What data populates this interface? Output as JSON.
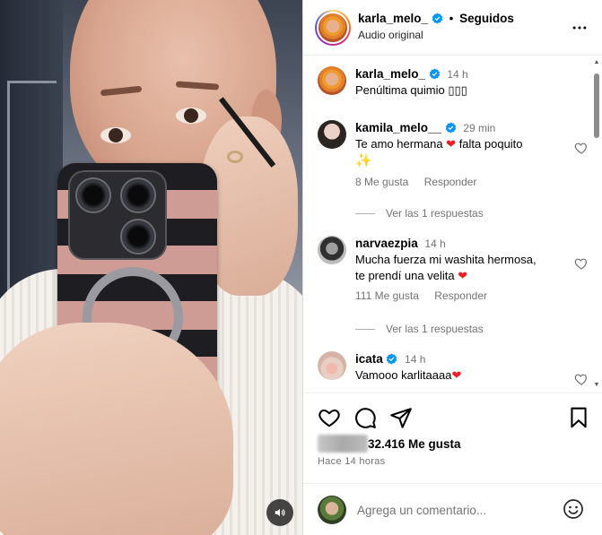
{
  "post": {
    "author": "karla_melo_",
    "follow_status": "Seguidos",
    "separator": "•",
    "audio": "Audio original",
    "more_icon": "more-horizontal-icon"
  },
  "comments": [
    {
      "username": "karla_melo_",
      "verified": true,
      "time": "14 h",
      "text": "Penúltima quimio ▯▯▯",
      "is_caption": true
    },
    {
      "username": "kamila_melo__",
      "verified": true,
      "time": "29 min",
      "text_before": "Te amo hermana ",
      "text_after": " falta poquito",
      "emoji_heart": "❤",
      "emoji_sparkle": "✨",
      "likes": "8 Me gusta",
      "reply": "Responder",
      "view_replies": "Ver las 1 respuestas"
    },
    {
      "username": "narvaezpia",
      "verified": false,
      "time": "14 h",
      "text_line1": "Mucha fuerza mi washita hermosa,",
      "text_line2": "te prendí una velita ",
      "emoji_heart": "❤",
      "likes": "111 Me gusta",
      "reply": "Responder",
      "view_replies": "Ver las 1 respuestas"
    },
    {
      "username": "icata",
      "verified": true,
      "time": "14 h",
      "text": "Vamooo karlitaaaa",
      "emoji_heart": "❤"
    }
  ],
  "actions": {
    "like_icon": "heart-icon",
    "comment_icon": "comment-bubble-icon",
    "share_icon": "paper-plane-icon",
    "save_icon": "bookmark-icon",
    "likes_count": "32.416 Me gusta",
    "posted_time": "Hace 14 horas"
  },
  "composer": {
    "placeholder": "Agrega un comentario...",
    "emoji_icon": "smiley-icon"
  },
  "media": {
    "volume_icon": "speaker-icon"
  },
  "colors": {
    "verified_blue": "#0095f6",
    "heart_red": "#ed1d25",
    "muted_text": "#737373",
    "border": "#dbdbdb"
  }
}
